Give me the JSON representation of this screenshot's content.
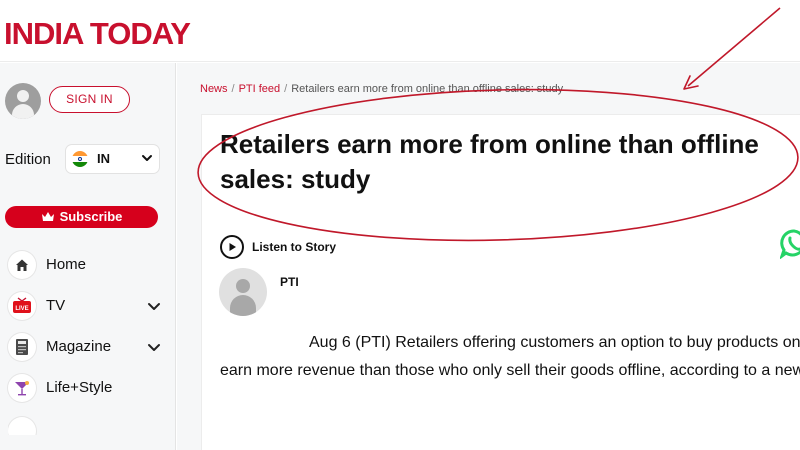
{
  "header": {
    "logo": "INDIA TODAY"
  },
  "sidebar": {
    "signin_label": "SIGN IN",
    "edition": {
      "label": "Edition",
      "value": "IN",
      "flag": "india-flag-icon"
    },
    "subscribe_label": "Subscribe",
    "nav": [
      {
        "label": "Home",
        "icon": "home-icon",
        "has_submenu": false
      },
      {
        "label": "TV",
        "icon": "live-tv-icon",
        "has_submenu": true
      },
      {
        "label": "Magazine",
        "icon": "magazine-icon",
        "has_submenu": true
      },
      {
        "label": "Life+Style",
        "icon": "cocktail-icon",
        "has_submenu": false
      }
    ]
  },
  "breadcrumb": {
    "items": [
      "News",
      "PTI feed",
      "Retailers earn more from online than offline sales: study"
    ],
    "separator": "/"
  },
  "article": {
    "title": "Retailers earn more from online than offline sales: study",
    "listen_label": "Listen to Story",
    "author": "PTI",
    "body": "Aug 6 (PTI) Retailers offering customers an option to buy products online earn more revenue than those who only sell their goods offline, according to a new study."
  },
  "colors": {
    "brand_red": "#c8102e",
    "subscribe_red": "#d6001c",
    "annotation_red": "#c0182a",
    "whatsapp_green": "#25d366"
  }
}
